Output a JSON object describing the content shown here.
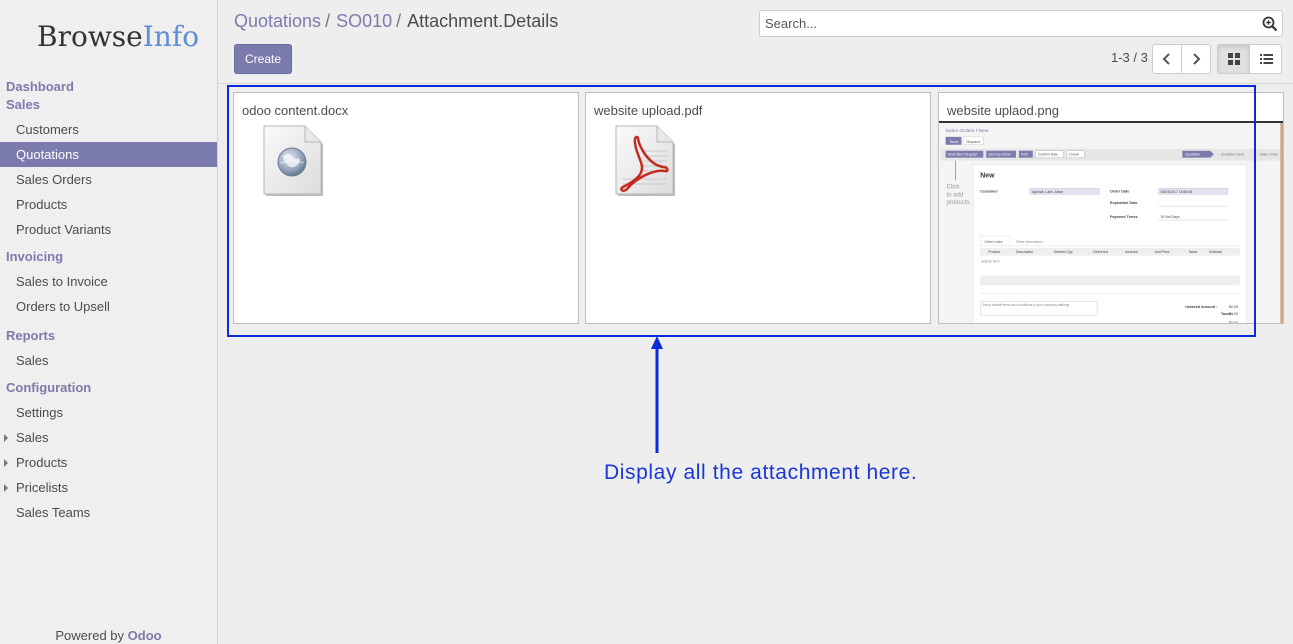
{
  "brand": {
    "name_part1": "Browse",
    "name_part2": "Info"
  },
  "sidebar": {
    "sections": [
      {
        "label": "Dashboard",
        "items": []
      },
      {
        "label": "Sales",
        "items": [
          {
            "label": "Customers"
          },
          {
            "label": "Quotations",
            "active": true
          },
          {
            "label": "Sales Orders"
          },
          {
            "label": "Products"
          },
          {
            "label": "Product Variants"
          }
        ]
      },
      {
        "label": "Invoicing",
        "items": [
          {
            "label": "Sales to Invoice"
          },
          {
            "label": "Orders to Upsell"
          }
        ]
      },
      {
        "label": "Reports",
        "items": [
          {
            "label": "Sales"
          }
        ]
      },
      {
        "label": "Configuration",
        "items": [
          {
            "label": "Settings"
          },
          {
            "label": "Sales",
            "expandable": true
          },
          {
            "label": "Products",
            "expandable": true
          },
          {
            "label": "Pricelists",
            "expandable": true
          },
          {
            "label": "Sales Teams"
          }
        ]
      }
    ],
    "powered_prefix": "Powered by",
    "powered_brand": "Odoo"
  },
  "breadcrumb": {
    "items": [
      "Quotations",
      "SO010",
      "Attachment.Details"
    ],
    "separator": "/"
  },
  "search": {
    "placeholder": "Search..."
  },
  "toolbar": {
    "create_label": "Create"
  },
  "pager": {
    "value": "1-3 / 3"
  },
  "attachments": [
    {
      "name": "odoo content.docx",
      "icon": "document-globe-icon"
    },
    {
      "name": "website upload.pdf",
      "icon": "pdf-icon"
    },
    {
      "name": "website uplaod.png",
      "icon": "image-preview"
    }
  ],
  "thumbnail": {
    "breadcrumb": "Sales Orders / New",
    "save": "Save",
    "discard": "Discard",
    "actions": [
      "Send Item Request",
      "Send by Email",
      "Print",
      "Confirm Sale",
      "Cancel"
    ],
    "statuses": [
      "Quotation",
      "Quotation Sent",
      "Sales Order"
    ],
    "hint": "Click to add products",
    "form_title": "New",
    "customer_label": "Customer",
    "customer_value": "Agrolait, Laith Jubair",
    "order_date_label": "Order Date",
    "order_date_value": "05/24/2017 15:58:28",
    "expiration_label": "Expiration Date",
    "payment_terms_label": "Payment Terms",
    "payment_terms_value": "30 Net Days",
    "tabs": [
      "Order Lines",
      "Other Information"
    ],
    "columns": [
      "Product",
      "Description",
      "Ordered Qty",
      "Delivered",
      "Invoiced",
      "Unit Price",
      "Taxes",
      "Subtotal"
    ],
    "add_item": "Add an item",
    "terms": "Setup default terms and conditions in your company settings.",
    "untaxed_label": "Untaxed Amount :",
    "untaxed_value": "$0.00",
    "taxes_label": "Taxes :",
    "taxes_value": "$0.00"
  },
  "annotation": {
    "text": "Display all the attachment here.",
    "color": "#1a36d6"
  },
  "colors": {
    "accent": "#7c7bad",
    "annotation_border": "#0a2bd9"
  }
}
